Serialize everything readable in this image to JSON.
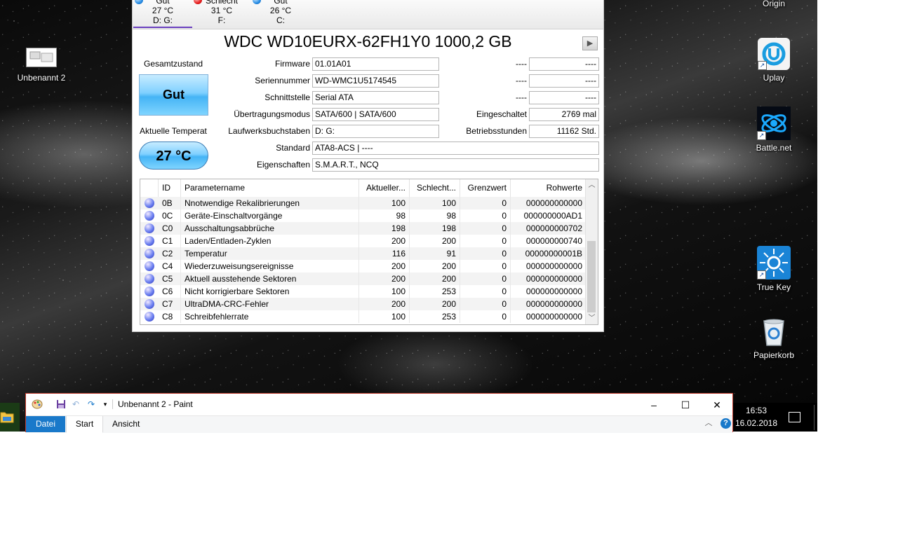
{
  "desktop": {
    "icons": [
      {
        "label": "Origin"
      },
      {
        "label": "Unbenannt 2"
      },
      {
        "label": "Uplay"
      },
      {
        "label": "Battle.net"
      },
      {
        "label": "True Key"
      },
      {
        "label": "Papierkorb"
      }
    ]
  },
  "cdi": {
    "drive_tabs": [
      {
        "status": "Gut",
        "temp": "27 °C",
        "letters": "D: G:",
        "color": "#2a8fe6"
      },
      {
        "status": "Schlecht",
        "temp": "31 °C",
        "letters": "F:",
        "color": "#e82020"
      },
      {
        "status": "Gut",
        "temp": "26 °C",
        "letters": "C:",
        "color": "#2a8fe6"
      }
    ],
    "model": "WDC WD10EURX-62FH1Y0 1000,2 GB",
    "health_label": "Gesamtzustand",
    "health_value": "Gut",
    "temp_label": "Aktuelle Temperat",
    "temp_value": "27 °C",
    "info": {
      "firmware_label": "Firmware",
      "firmware": "01.01A01",
      "serial_label": "Seriennummer",
      "serial": "WD-WMC1U5174545",
      "interface_label": "Schnittstelle",
      "interface": "Serial ATA",
      "transfer_label": "Übertragungsmodus",
      "transfer": "SATA/600 | SATA/600",
      "letters_label": "Laufwerksbuchstaben",
      "letters": "D: G:",
      "standard_label": "Standard",
      "standard": "ATA8-ACS | ----",
      "features_label": "Eigenschaften",
      "features": "S.M.A.R.T., NCQ",
      "r1_label": "----",
      "r1_value": "----",
      "r2_label": "----",
      "r2_value": "----",
      "r3_label": "----",
      "r3_value": "----",
      "power_on_count_label": "Eingeschaltet",
      "power_on_count": "2769 mal",
      "power_on_hours_label": "Betriebsstunden",
      "power_on_hours": "11162 Std."
    },
    "smart": {
      "headers": [
        "ID",
        "Parametername",
        "Aktueller...",
        "Schlecht...",
        "Grenzwert",
        "Rohwerte"
      ],
      "rows": [
        {
          "id": "0B",
          "name": "Nnotwendige Rekalibrierungen",
          "current": "100",
          "worst": "100",
          "threshold": "0",
          "raw": "000000000000"
        },
        {
          "id": "0C",
          "name": "Geräte-Einschaltvorgänge",
          "current": "98",
          "worst": "98",
          "threshold": "0",
          "raw": "000000000AD1"
        },
        {
          "id": "C0",
          "name": "Ausschaltungsabbrüche",
          "current": "198",
          "worst": "198",
          "threshold": "0",
          "raw": "000000000702"
        },
        {
          "id": "C1",
          "name": "Laden/Entladen-Zyklen",
          "current": "200",
          "worst": "200",
          "threshold": "0",
          "raw": "000000000740"
        },
        {
          "id": "C2",
          "name": "Temperatur",
          "current": "116",
          "worst": "91",
          "threshold": "0",
          "raw": "00000000001B"
        },
        {
          "id": "C4",
          "name": "Wiederzuweisungsereignisse",
          "current": "200",
          "worst": "200",
          "threshold": "0",
          "raw": "000000000000"
        },
        {
          "id": "C5",
          "name": "Aktuell ausstehende Sektoren",
          "current": "200",
          "worst": "200",
          "threshold": "0",
          "raw": "000000000000"
        },
        {
          "id": "C6",
          "name": "Nicht korrigierbare Sektoren",
          "current": "100",
          "worst": "253",
          "threshold": "0",
          "raw": "000000000000"
        },
        {
          "id": "C7",
          "name": "UltraDMA-CRC-Fehler",
          "current": "200",
          "worst": "200",
          "threshold": "0",
          "raw": "000000000000"
        },
        {
          "id": "C8",
          "name": "Schreibfehlerrate",
          "current": "100",
          "worst": "253",
          "threshold": "0",
          "raw": "000000000000"
        }
      ]
    }
  },
  "paint": {
    "title": "Unbenannt 2 - Paint",
    "tabs": [
      "Datei",
      "Start",
      "Ansicht"
    ],
    "help": "?"
  },
  "taskbar": {
    "time": "16:53",
    "date": "16.02.2018"
  },
  "colors": {
    "accent": "#1979ca",
    "good": "#2a8fe6",
    "bad": "#e82020",
    "paint_border": "#c0392b"
  }
}
